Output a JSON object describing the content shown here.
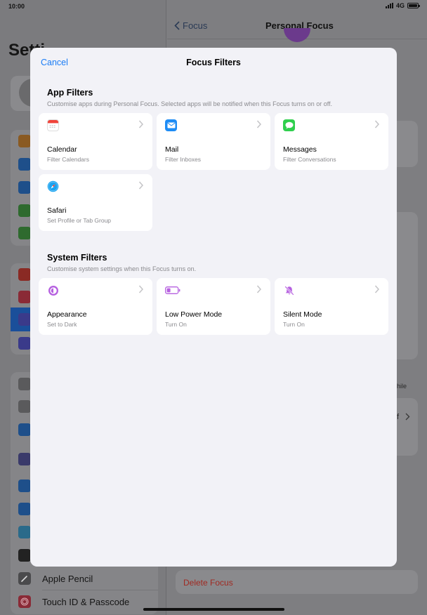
{
  "status_bar": {
    "time": "10:00",
    "network": "4G"
  },
  "background": {
    "sidebar_title": "Setti",
    "sidebar_rows": [
      {
        "label": "Apple Pencil",
        "icon": "pencil-icon"
      },
      {
        "label": "Touch ID & Passcode",
        "icon": "fingerprint-icon"
      }
    ],
    "nav_back": "Focus",
    "nav_title": "Personal Focus",
    "delete_label": "Delete Focus",
    "fragment_while": "hile",
    "fragment_off": "f"
  },
  "sheet": {
    "cancel": "Cancel",
    "title": "Focus Filters",
    "app_filters": {
      "title": "App Filters",
      "subtitle": "Customise apps during Personal Focus. Selected apps will be notified when this Focus turns on or off.",
      "items": [
        {
          "name": "Calendar",
          "sub": "Filter Calendars",
          "icon": "calendar-icon"
        },
        {
          "name": "Mail",
          "sub": "Filter Inboxes",
          "icon": "mail-icon"
        },
        {
          "name": "Messages",
          "sub": "Filter Conversations",
          "icon": "messages-icon"
        },
        {
          "name": "Safari",
          "sub": "Set Profile or Tab Group",
          "icon": "safari-icon"
        }
      ]
    },
    "system_filters": {
      "title": "System Filters",
      "subtitle": "Customise system settings when this Focus turns on.",
      "items": [
        {
          "name": "Appearance",
          "sub": "Set to Dark",
          "icon": "appearance-icon"
        },
        {
          "name": "Low Power Mode",
          "sub": "Turn On",
          "icon": "battery-icon"
        },
        {
          "name": "Silent Mode",
          "sub": "Turn On",
          "icon": "bell-slash-icon"
        }
      ]
    }
  },
  "colors": {
    "accent": "#1a7cf5",
    "destructive": "#a02a22",
    "system_purple": "#b660e0"
  }
}
